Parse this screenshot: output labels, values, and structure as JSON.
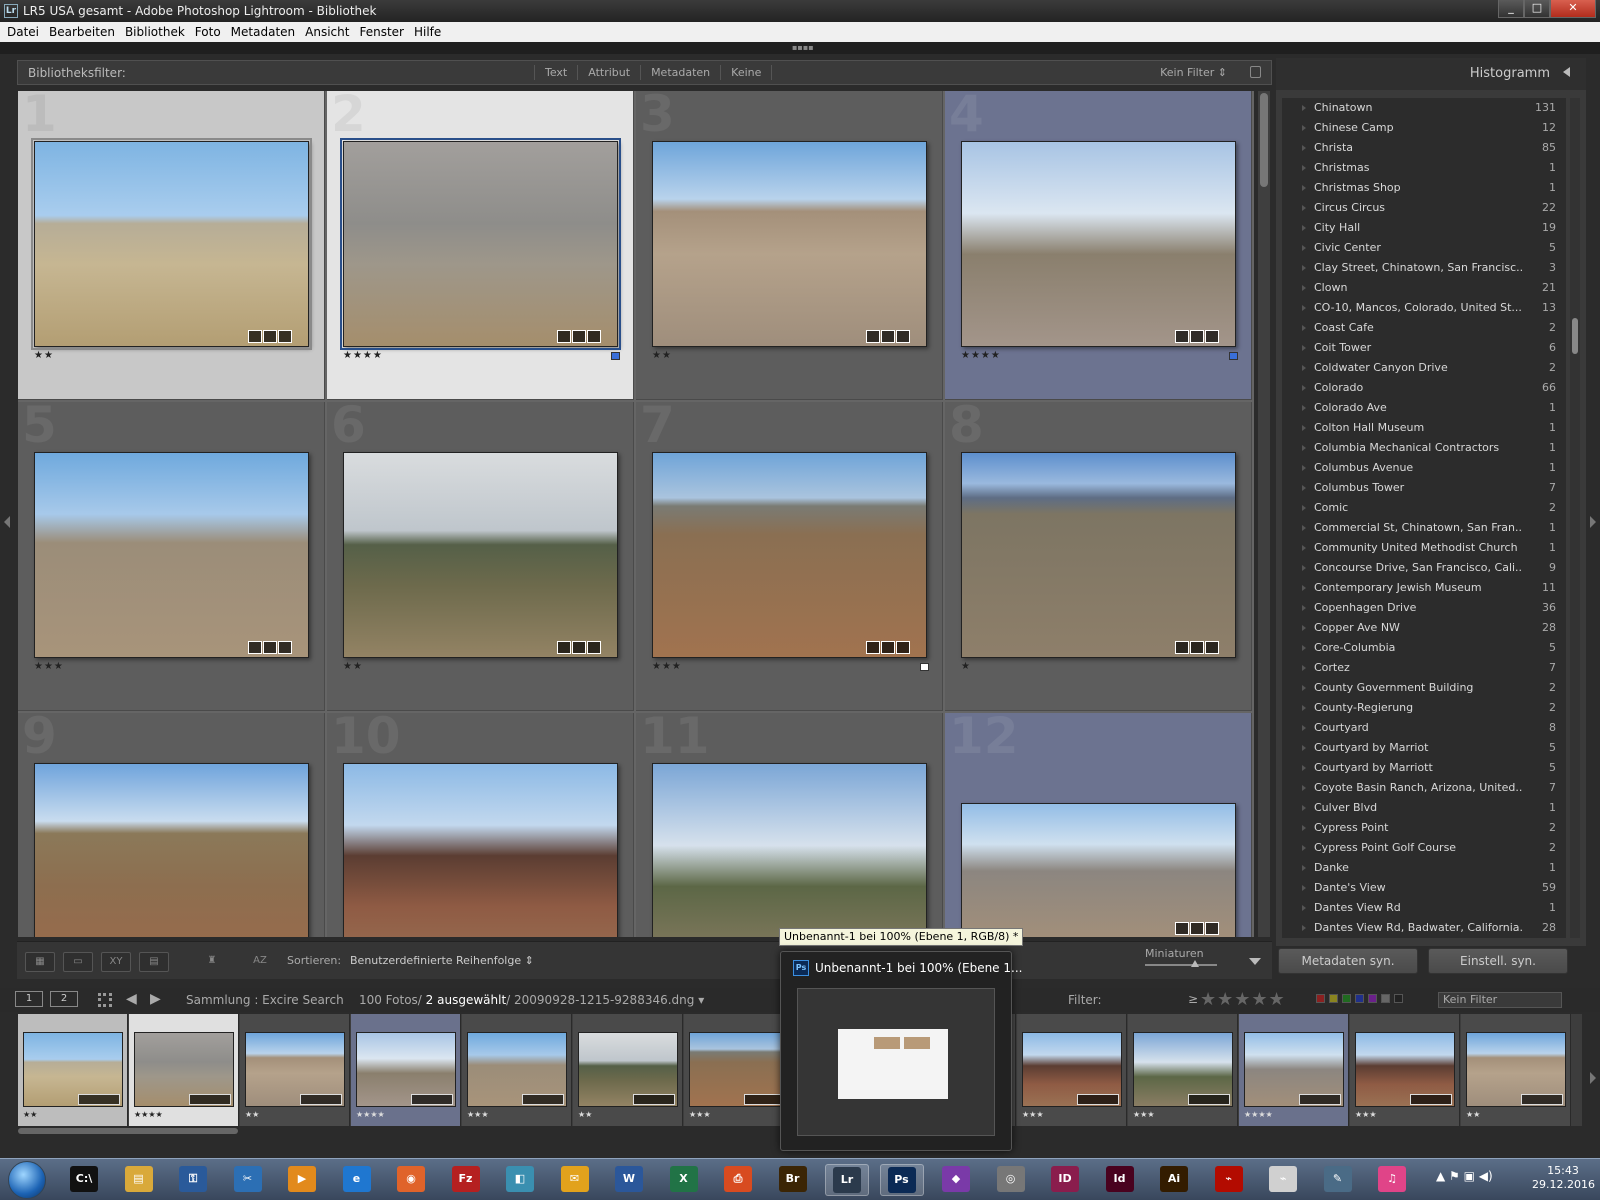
{
  "window": {
    "title": "LR5 USA gesamt - Adobe Photoshop Lightroom - Bibliothek",
    "logo": "Lr",
    "minimize": "_",
    "maximize": "□",
    "close": "✕"
  },
  "menu": [
    "Datei",
    "Bearbeiten",
    "Bibliothek",
    "Foto",
    "Metadaten",
    "Ansicht",
    "Fenster",
    "Hilfe"
  ],
  "filter_bar": {
    "label": "Bibliotheksfilter:",
    "tabs": [
      "Text",
      "Attribut",
      "Metadaten",
      "Keine"
    ],
    "preset": "Kein Filter ⇕"
  },
  "grid": [
    {
      "num": "1",
      "stars": "★★",
      "state": "sel1",
      "photo": "p1",
      "label_color": ""
    },
    {
      "num": "2",
      "stars": "★★★★",
      "state": "sel2",
      "photo": "p2",
      "label_color": "#3a6fd8"
    },
    {
      "num": "3",
      "stars": "★★",
      "state": "normal",
      "photo": "p3",
      "label_color": ""
    },
    {
      "num": "4",
      "stars": "★★★★",
      "state": "blue",
      "photo": "p4",
      "label_color": "#3a6fd8"
    },
    {
      "num": "5",
      "stars": "★★★",
      "state": "normal",
      "photo": "p5",
      "label_color": ""
    },
    {
      "num": "6",
      "stars": "★★",
      "state": "normal",
      "photo": "p6",
      "label_color": ""
    },
    {
      "num": "7",
      "stars": "★★★",
      "state": "normal",
      "photo": "p7",
      "label_color": "#ffffff"
    },
    {
      "num": "8",
      "stars": "★",
      "state": "normal",
      "photo": "p8",
      "label_color": ""
    },
    {
      "num": "9",
      "stars": "",
      "state": "normal",
      "photo": "p9",
      "label_color": ""
    },
    {
      "num": "10",
      "stars": "",
      "state": "normal",
      "photo": "p10",
      "label_color": ""
    },
    {
      "num": "11",
      "stars": "",
      "state": "normal",
      "photo": "p11",
      "label_color": ""
    },
    {
      "num": "12",
      "stars": "",
      "state": "blue",
      "photo": "p12",
      "label_color": ""
    }
  ],
  "right_panel": {
    "header": "Histogramm",
    "keywords": [
      {
        "name": "Chinatown",
        "count": "131"
      },
      {
        "name": "Chinese Camp",
        "count": "12"
      },
      {
        "name": "Christa",
        "count": "85"
      },
      {
        "name": "Christmas",
        "count": "1"
      },
      {
        "name": "Christmas Shop",
        "count": "1"
      },
      {
        "name": "Circus Circus",
        "count": "22"
      },
      {
        "name": "City Hall",
        "count": "19"
      },
      {
        "name": "Civic Center",
        "count": "5"
      },
      {
        "name": "Clay Street, Chinatown, San Francisc...",
        "count": "3"
      },
      {
        "name": "Clown",
        "count": "21"
      },
      {
        "name": "CO-10, Mancos, Colorado, United St...",
        "count": "13"
      },
      {
        "name": "Coast Cafe",
        "count": "2"
      },
      {
        "name": "Coit Tower",
        "count": "6"
      },
      {
        "name": "Coldwater Canyon Drive",
        "count": "2"
      },
      {
        "name": "Colorado",
        "count": "66"
      },
      {
        "name": "Colorado Ave",
        "count": "1"
      },
      {
        "name": "Colton Hall Museum",
        "count": "1"
      },
      {
        "name": "Columbia Mechanical Contractors",
        "count": "1"
      },
      {
        "name": "Columbus Avenue",
        "count": "1"
      },
      {
        "name": "Columbus Tower",
        "count": "7"
      },
      {
        "name": "Comic",
        "count": "2"
      },
      {
        "name": "Commercial St, Chinatown, San Fran...",
        "count": "1"
      },
      {
        "name": "Community United Methodist Church",
        "count": "1"
      },
      {
        "name": "Concourse Drive, San Francisco, Cali...",
        "count": "9"
      },
      {
        "name": "Contemporary Jewish Museum",
        "count": "11"
      },
      {
        "name": "Copenhagen Drive",
        "count": "36"
      },
      {
        "name": "Copper Ave NW",
        "count": "28"
      },
      {
        "name": "Core-Columbia",
        "count": "5"
      },
      {
        "name": "Cortez",
        "count": "7"
      },
      {
        "name": "County Government Building",
        "count": "2"
      },
      {
        "name": "County-Regierung",
        "count": "2"
      },
      {
        "name": "Courtyard",
        "count": "8"
      },
      {
        "name": "Courtyard by Marriot",
        "count": "5"
      },
      {
        "name": "Courtyard by Marriott",
        "count": "5"
      },
      {
        "name": "Coyote Basin Ranch, Arizona, United...",
        "count": "7"
      },
      {
        "name": "Culver Blvd",
        "count": "1"
      },
      {
        "name": "Cypress Point",
        "count": "2"
      },
      {
        "name": "Cypress Point Golf Course",
        "count": "2"
      },
      {
        "name": "Danke",
        "count": "1"
      },
      {
        "name": "Dante's View",
        "count": "59"
      },
      {
        "name": "Dantes View Rd",
        "count": "1"
      },
      {
        "name": "Dantes View Rd, Badwater, California...",
        "count": "28"
      }
    ],
    "sync_metadata": "Metadaten syn.",
    "sync_settings": "Einstell. syn."
  },
  "toolbar": {
    "sort_label": "Sortieren:",
    "sort_value": "Benutzerdefinierte Reihenfolge ⇕",
    "thumb_label": "Miniaturen",
    "thumb_size": 0.7
  },
  "strip_bar": {
    "view1": "1",
    "view2": "2",
    "prev": "◀",
    "next": "▶",
    "collection": "Sammlung : Excire Search",
    "count": "100 Fotos/",
    "selected": "2 ausgewählt",
    "file": "/ 20090928-1215-9288346.dng ▾",
    "filter_label": "Filter:",
    "rating_op": "≥",
    "rating_stars": "★★★★★",
    "preset": "Kein Filter"
  },
  "filmstrip": [
    {
      "photo": "p1",
      "stars": "★★",
      "state": "sel1"
    },
    {
      "photo": "p2",
      "stars": "★★★★",
      "state": "sel2"
    },
    {
      "photo": "p3",
      "stars": "★★",
      "state": "normal"
    },
    {
      "photo": "p4",
      "stars": "★★★★",
      "state": "blue"
    },
    {
      "photo": "p5",
      "stars": "★★★",
      "state": "normal"
    },
    {
      "photo": "p6",
      "stars": "★★",
      "state": "normal"
    },
    {
      "photo": "p7",
      "stars": "★★★",
      "state": "normal"
    },
    {
      "photo": "p8",
      "stars": "",
      "state": "normal"
    },
    {
      "photo": "p9",
      "stars": "",
      "state": "normal"
    },
    {
      "photo": "p10",
      "stars": "★★★",
      "state": "normal"
    },
    {
      "photo": "p11",
      "stars": "★★★",
      "state": "normal"
    },
    {
      "photo": "p12",
      "stars": "★★★★",
      "state": "blue"
    },
    {
      "photo": "p10",
      "stars": "★★★",
      "state": "normal"
    },
    {
      "photo": "p3",
      "stars": "★★",
      "state": "normal"
    }
  ],
  "ps_preview": {
    "tooltip": "Unbenannt-1 bei 100% (Ebene 1, RGB/8) *",
    "title": "Unbenannt-1 bei 100% (Ebene 1...",
    "icon": "Ps"
  },
  "taskbar": {
    "apps": [
      {
        "name": "cmd",
        "label": "C:\\",
        "color": "#111"
      },
      {
        "name": "explorer",
        "label": "▤",
        "color": "#d9a93a"
      },
      {
        "name": "keys",
        "label": "⚿",
        "color": "#2a5a9a"
      },
      {
        "name": "tools",
        "label": "✂",
        "color": "#2c6fb4"
      },
      {
        "name": "player",
        "label": "▶",
        "color": "#e28a1c"
      },
      {
        "name": "ie",
        "label": "e",
        "color": "#1f77d0"
      },
      {
        "name": "firefox",
        "label": "◉",
        "color": "#e0632a"
      },
      {
        "name": "filezilla",
        "label": "Fz",
        "color": "#b52020"
      },
      {
        "name": "notes",
        "label": "◧",
        "color": "#3a8fb0"
      },
      {
        "name": "outlook",
        "label": "✉",
        "color": "#e2a21c"
      },
      {
        "name": "word",
        "label": "W",
        "color": "#2b579a"
      },
      {
        "name": "excel",
        "label": "X",
        "color": "#217346"
      },
      {
        "name": "pdf-tool",
        "label": "⎙",
        "color": "#d84b20"
      },
      {
        "name": "bridge",
        "label": "Br",
        "color": "#3b2505"
      },
      {
        "name": "lightroom",
        "label": "Lr",
        "color": "#2b3a4c"
      },
      {
        "name": "photoshop",
        "label": "Ps",
        "color": "#0b2a55"
      },
      {
        "name": "affinity",
        "label": "◆",
        "color": "#7a3aa8"
      },
      {
        "name": "camera",
        "label": "◎",
        "color": "#777"
      },
      {
        "name": "indesign-a",
        "label": "ID",
        "color": "#8a1d4d"
      },
      {
        "name": "indesign-b",
        "label": "Id",
        "color": "#49021f"
      },
      {
        "name": "illustrator",
        "label": "Ai",
        "color": "#331c00"
      },
      {
        "name": "acrobat-a",
        "label": "⌁",
        "color": "#b30b00"
      },
      {
        "name": "acrobat-b",
        "label": "⌁",
        "color": "#d0d0d0"
      },
      {
        "name": "pen",
        "label": "✎",
        "color": "#4a6b86"
      },
      {
        "name": "itunes",
        "label": "♫",
        "color": "#e04488"
      }
    ],
    "tray": "▲ ⚑ ▣ ◀)",
    "time": "15:43",
    "date": "29.12.2016"
  }
}
